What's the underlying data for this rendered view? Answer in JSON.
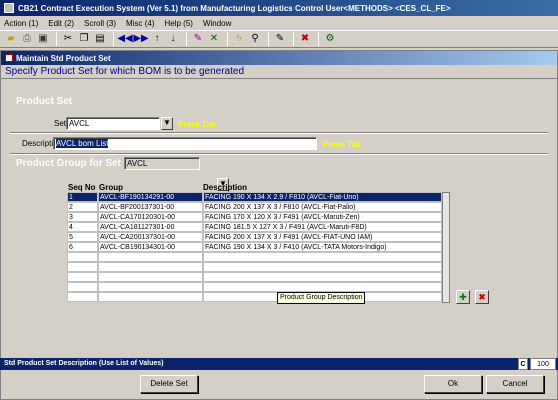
{
  "window": {
    "title": "CB21 Contract Execution System (Ver 5.1) from Manufacturing Logistics Control User<METHODS> <CES_CL_FE>"
  },
  "menu": {
    "items": [
      "Action (1)",
      "Edit (2)",
      "Scroll (3)",
      "Misc (4)",
      "Help (5)",
      "Window"
    ]
  },
  "toolbar": {
    "icons": [
      "open-folder-icon",
      "print-icon",
      "save-icon",
      "cut-icon",
      "copy-icon",
      "paste-icon",
      "first-record-icon",
      "previous-record-icon",
      "next-record-icon",
      "last-record-icon",
      "insert-record-icon",
      "delete-record-icon",
      "execute-query-icon",
      "enter-query-icon",
      "lov-icon",
      "exit-icon",
      "help-icon"
    ]
  },
  "form": {
    "title": "Maintain Std Product Set",
    "hint": "Specify Product Set for which BOM is to be generated",
    "product_set_section": "Product Set",
    "set_label": "Set",
    "set_value": "AVCL",
    "set_press_tab": "Press Tab",
    "description_label": "Description",
    "description_value": "AVCL bom List",
    "description_press_tab": "Press Tab",
    "group_section": "Product Group for Set",
    "group_set_value": "AVCL"
  },
  "grid": {
    "columns": [
      "Seq No",
      "Group",
      "Description"
    ],
    "rows": [
      {
        "seq": "1",
        "group": "AVCL-BF190134291-00",
        "desc": "FACING 190 X 134 X 2.9 / F810 (AVCL-Fiat-Uno)"
      },
      {
        "seq": "2",
        "group": "AVCL-BF200137301-00",
        "desc": "FACING 200 X 137 X 3 / F810 (AVCL-Fiat-Palio)"
      },
      {
        "seq": "3",
        "group": "AVCL-CA170120301-00",
        "desc": "FACING 170 X 120 X 3 / F491 (AVCL-Maruti-Zen)"
      },
      {
        "seq": "4",
        "group": "AVCL-CA181127301-00",
        "desc": "FACING 181.5 X 127 X 3 / F491 (AVCL-Maruti-F8D)"
      },
      {
        "seq": "5",
        "group": "AVCL-CA200137301-00",
        "desc": "FACING 200 X 137 X 3 / F491 (AVCL-FIAT-UNO IAM)"
      },
      {
        "seq": "6",
        "group": "AVCL-CB190134301-00",
        "desc": "FACING 190 X 134 X 3 / F410 (AVCL-TATA Motors-Indigo)"
      },
      {
        "seq": "",
        "group": "",
        "desc": ""
      },
      {
        "seq": "",
        "group": "",
        "desc": ""
      },
      {
        "seq": "",
        "group": "",
        "desc": ""
      },
      {
        "seq": "",
        "group": "",
        "desc": ""
      },
      {
        "seq": "",
        "group": "",
        "desc": ""
      }
    ],
    "tooltip": "Product Group Description"
  },
  "status": {
    "message": "Std Product Set Description (Use List of Values)",
    "mode": "C",
    "count": "100"
  },
  "buttons": {
    "delete_set": "Delete Set",
    "ok": "Ok",
    "cancel": "Cancel"
  },
  "colors": {
    "selection": "#0a246a",
    "press_tab": "#ffff00",
    "hint_text": "#00008b"
  }
}
